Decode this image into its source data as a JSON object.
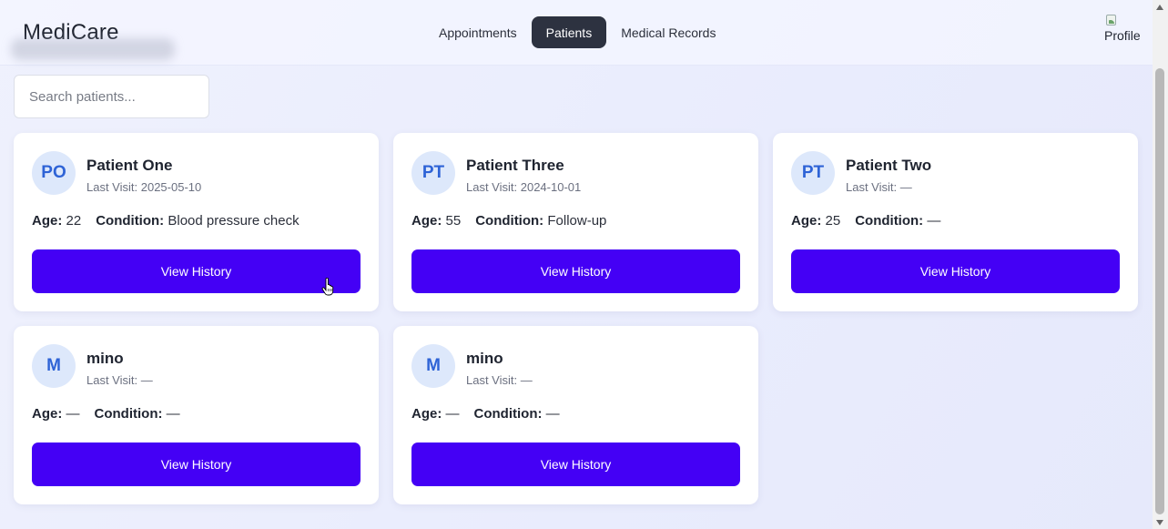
{
  "header": {
    "brand": "MediCare",
    "nav": [
      {
        "label": "Appointments",
        "active": false
      },
      {
        "label": "Patients",
        "active": true
      },
      {
        "label": "Medical Records",
        "active": false
      }
    ],
    "profile_alt": "Profile"
  },
  "search": {
    "placeholder": "Search patients...",
    "value": ""
  },
  "labels": {
    "age": "Age:",
    "condition": "Condition:",
    "view_history": "View History"
  },
  "patients": [
    {
      "initials": "PO",
      "name": "Patient One",
      "last_visit": "Last Visit: 2025-05-10",
      "age": "22",
      "condition": "Blood pressure check"
    },
    {
      "initials": "PT",
      "name": "Patient Three",
      "last_visit": "Last Visit: 2024-10-01",
      "age": "55",
      "condition": "Follow-up"
    },
    {
      "initials": "PT",
      "name": "Patient Two",
      "last_visit": "Last Visit: —",
      "age": "25",
      "condition": "—"
    },
    {
      "initials": "M",
      "name": "mino",
      "last_visit": "Last Visit: —",
      "age": "—",
      "condition": "—"
    },
    {
      "initials": "M",
      "name": "mino",
      "last_visit": "Last Visit: —",
      "age": "—",
      "condition": "—"
    }
  ],
  "colors": {
    "accent": "#4400f5",
    "nav_active_bg": "#2d3240",
    "avatar_bg": "#dde8fb",
    "avatar_text": "#2e63d6"
  }
}
